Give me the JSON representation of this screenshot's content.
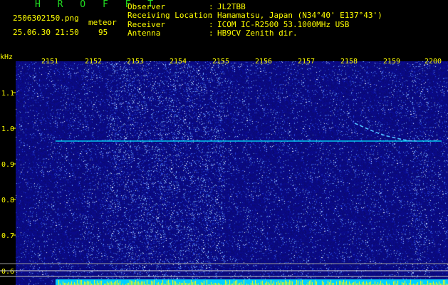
{
  "app": {
    "brand": "H R O F F T",
    "filename": "2506302150.png",
    "detection_label": "meteor",
    "detection_count": "95",
    "datetime": "25.06.30 21:50"
  },
  "station": [
    {
      "key": "Observer",
      "value": "JL2TBB"
    },
    {
      "key": "Receiving Location",
      "value": "Hamamatsu, Japan (N34°40' E137°43')"
    },
    {
      "key": "Receiver",
      "value": "ICOM IC-R2500 53.1000MHz USB"
    },
    {
      "key": "Antenna",
      "value": "HB9CV Zenith dir."
    }
  ],
  "separator": ":",
  "axes": {
    "y_unit": "kHz",
    "y_ticks": [
      "1.1",
      "1.0",
      "0.9",
      "0.8",
      "0.7",
      "0.6"
    ],
    "x_ticks": [
      "2151",
      "2152",
      "2153",
      "2154",
      "2155",
      "2156",
      "2157",
      "2158",
      "2159",
      "2200"
    ]
  },
  "colors": {
    "background": "#000000",
    "header_text": "#ffff00",
    "brand_text": "#22dd22",
    "spectrogram_base": "#0a0a8c",
    "carrier_line": "#00e5ff",
    "meteor_echo": "#4fb8ff"
  }
}
